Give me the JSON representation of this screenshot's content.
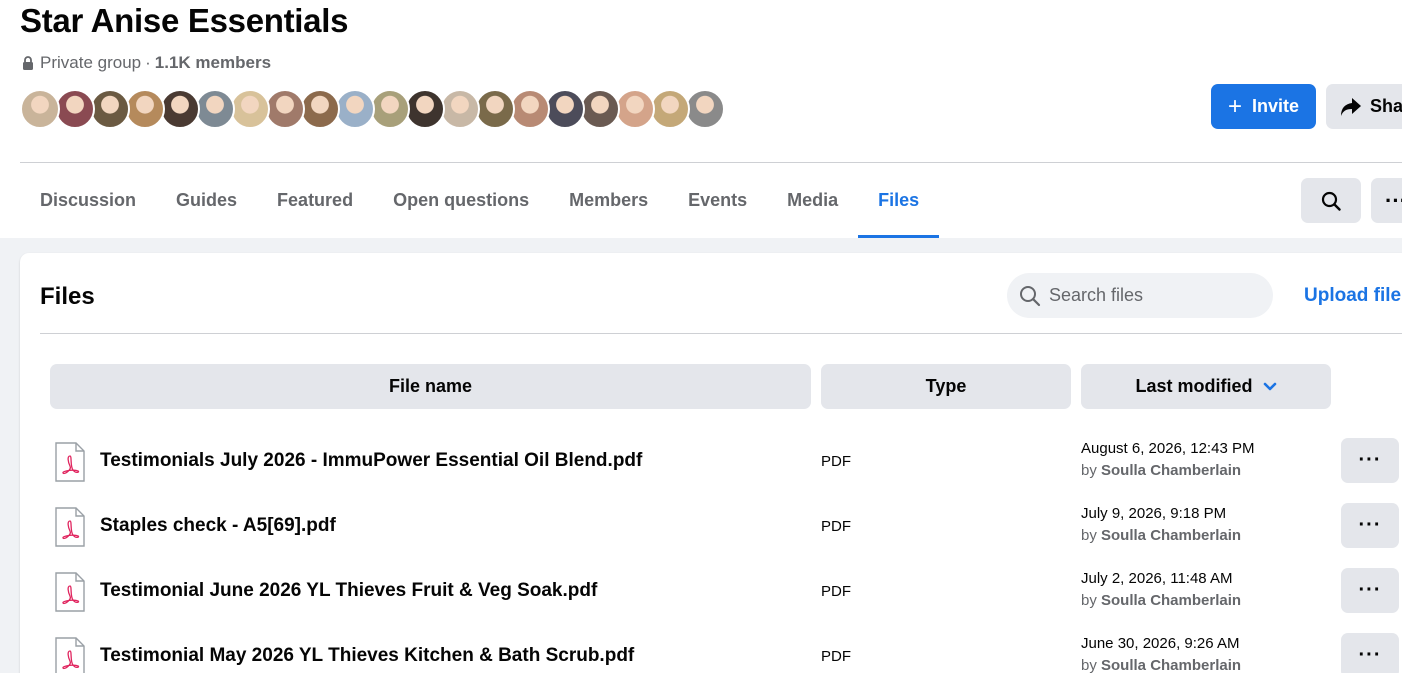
{
  "group": {
    "title": "Star Anise Essentials",
    "privacy": "Private group",
    "separator": "·",
    "members": "1.1K members"
  },
  "avatars": [
    {
      "name": "member-1",
      "color": "#c9b49a"
    },
    {
      "name": "member-2",
      "color": "#8a4a52"
    },
    {
      "name": "member-3",
      "color": "#6b5a42"
    },
    {
      "name": "member-4",
      "color": "#b58a5c"
    },
    {
      "name": "member-5",
      "color": "#4a3a32"
    },
    {
      "name": "member-6",
      "color": "#7e8a94"
    },
    {
      "name": "member-7",
      "color": "#d8c29a"
    },
    {
      "name": "member-8",
      "color": "#a07a6a"
    },
    {
      "name": "member-9",
      "color": "#8c6a4c"
    },
    {
      "name": "member-10",
      "color": "#9ab0c8"
    },
    {
      "name": "member-11",
      "color": "#a8a07a"
    },
    {
      "name": "member-12",
      "color": "#3e342e"
    },
    {
      "name": "member-13",
      "color": "#c8b8a6"
    },
    {
      "name": "member-14",
      "color": "#7a6a4a"
    },
    {
      "name": "member-15",
      "color": "#b88a74"
    },
    {
      "name": "member-16",
      "color": "#4c4c5a"
    },
    {
      "name": "member-17",
      "color": "#6a5a52"
    },
    {
      "name": "member-18",
      "color": "#d4a48a"
    },
    {
      "name": "member-19",
      "color": "#c4a878"
    },
    {
      "name": "member-20",
      "color": "#8a8a8a"
    }
  ],
  "actions": {
    "invite_label": "Invite",
    "share_label": "Share"
  },
  "tabs": [
    {
      "label": "Discussion",
      "active": false
    },
    {
      "label": "Guides",
      "active": false
    },
    {
      "label": "Featured",
      "active": false
    },
    {
      "label": "Open questions",
      "active": false
    },
    {
      "label": "Members",
      "active": false
    },
    {
      "label": "Events",
      "active": false
    },
    {
      "label": "Media",
      "active": false
    },
    {
      "label": "Files",
      "active": true
    }
  ],
  "more_label": "···",
  "files": {
    "title": "Files",
    "search_placeholder": "Search files",
    "upload_label": "Upload file",
    "columns": {
      "name": "File name",
      "type": "Type",
      "modified": "Last modified"
    },
    "by_prefix": "by",
    "rows": [
      {
        "name": "Testimonials July 2026 - ImmuPower Essential Oil Blend.pdf",
        "type": "PDF",
        "date": "August 6, 2026, 12:43 PM",
        "author": "Soulla Chamberlain"
      },
      {
        "name": "Staples check - A5[69].pdf",
        "type": "PDF",
        "date": "July 9, 2026, 9:18 PM",
        "author": "Soulla Chamberlain"
      },
      {
        "name": "Testimonial June 2026 YL Thieves Fruit & Veg Soak.pdf",
        "type": "PDF",
        "date": "July 2, 2026, 11:48 AM",
        "author": "Soulla Chamberlain"
      },
      {
        "name": "Testimonial May 2026 YL Thieves Kitchen & Bath Scrub.pdf",
        "type": "PDF",
        "date": "June 30, 2026, 9:26 AM",
        "author": "Soulla Chamberlain"
      }
    ]
  },
  "colors": {
    "accent": "#1b74e4",
    "pdf_icon": "#e0245e"
  },
  "icons": {
    "privacy": "lock-icon",
    "invite": "plus-icon",
    "share": "share-arrow-icon",
    "search": "search-icon",
    "more": "more-icon",
    "sort": "chevron-down-icon",
    "file": "pdf-file-icon"
  }
}
